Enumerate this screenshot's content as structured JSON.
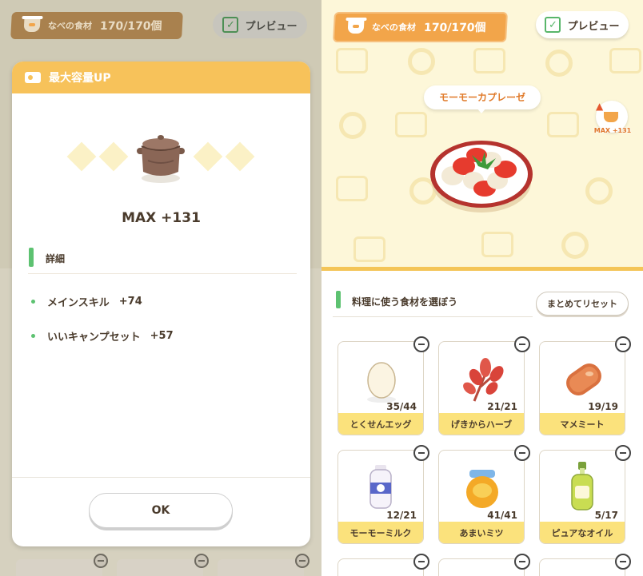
{
  "header": {
    "pot_label": "なべの食材",
    "pot_count": "170/170個",
    "preview_label": "プレビュー"
  },
  "modal": {
    "title": "最大容量UP",
    "max_text": "MAX +131",
    "detail_label": "詳細",
    "bonuses": [
      {
        "label": "メインスキル",
        "value": "+74"
      },
      {
        "label": "いいキャンプセット",
        "value": "+57"
      }
    ],
    "ok_label": "OK"
  },
  "dish": {
    "name": "モーモーカプレーゼ",
    "max_badge": "MAX +131"
  },
  "ingredients_section": {
    "title": "料理に使う食材を選ぼう",
    "reset_label": "まとめてリセット"
  },
  "ingredients": [
    {
      "name": "とくせんエッグ",
      "qty": "35/44",
      "icon": "egg-icon"
    },
    {
      "name": "げきからハーブ",
      "qty": "21/21",
      "icon": "herb-icon"
    },
    {
      "name": "マメミート",
      "qty": "19/19",
      "icon": "meat-icon"
    },
    {
      "name": "モーモーミルク",
      "qty": "12/21",
      "icon": "milk-icon"
    },
    {
      "name": "あまいミツ",
      "qty": "41/41",
      "icon": "honey-icon"
    },
    {
      "name": "ピュアなオイル",
      "qty": "5/17",
      "icon": "oil-icon"
    }
  ],
  "colors": {
    "accent_orange": "#f2a54a",
    "modal_header": "#f7c25a",
    "label_yellow": "#fbe27c",
    "section_green": "#5dc271"
  }
}
